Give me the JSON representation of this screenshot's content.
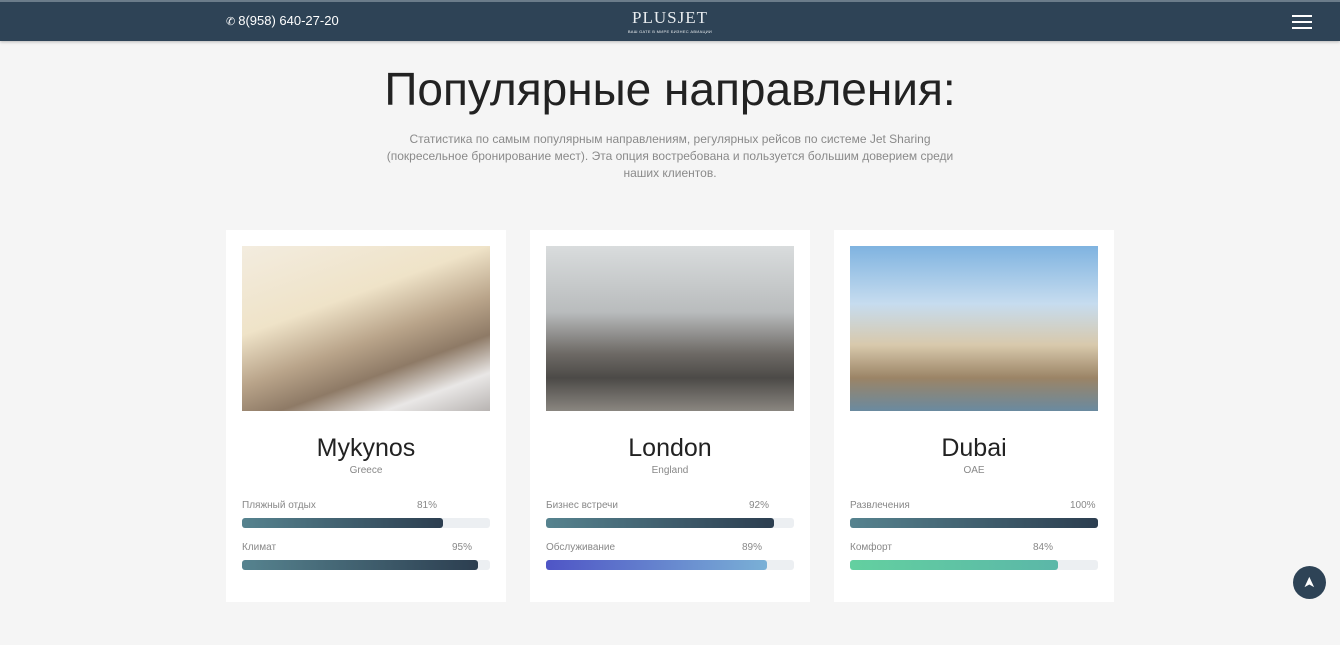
{
  "header": {
    "phone": "8(958) 640-27-20",
    "logo_name": "PLUSJET",
    "logo_tagline": "ВАШ GATE В МИРЕ БИЗНЕС АВИАЦИИ"
  },
  "section": {
    "title": "Популярные направления:",
    "lead": "Статистика по самым популярным направлениям, регулярных рейсов по системе Jet Sharing (покресельное бронирование мест). Эта опция востребована и пользуется большим доверием среди наших клиентов."
  },
  "cards": [
    {
      "city": "Mykynos",
      "country": "Greece",
      "skills": [
        {
          "label": "Пляжный отдых",
          "value": 81,
          "pct": "81%"
        },
        {
          "label": "Климат",
          "value": 95,
          "pct": "95%"
        }
      ]
    },
    {
      "city": "London",
      "country": "England",
      "skills": [
        {
          "label": "Бизнес встречи",
          "value": 92,
          "pct": "92%"
        },
        {
          "label": "Обслуживание",
          "value": 89,
          "pct": "89%"
        }
      ]
    },
    {
      "city": "Dubai",
      "country": "OAE",
      "skills": [
        {
          "label": "Развлечения",
          "value": 100,
          "pct": "100%"
        },
        {
          "label": "Комфорт",
          "value": 84,
          "pct": "84%"
        }
      ]
    }
  ],
  "colors": {
    "header": "#2e4356",
    "bar_default": "#2c3e50",
    "bar_blue": "#5058c8",
    "bar_green": "#5ec79f"
  }
}
